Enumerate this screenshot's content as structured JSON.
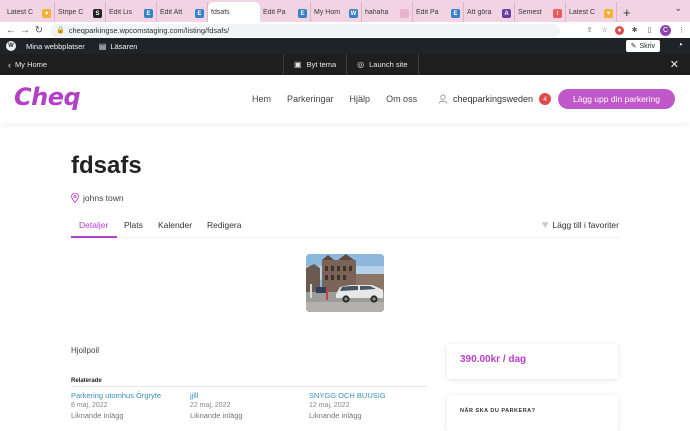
{
  "browser": {
    "tabs": [
      {
        "title": "Latest C",
        "fav_color": "#f2b233",
        "fav_glyph": "♥"
      },
      {
        "title": "Stripe C",
        "fav_color": "#222222",
        "fav_glyph": "S"
      },
      {
        "title": "Edit Lis",
        "fav_color": "#3582c4",
        "fav_glyph": "E"
      },
      {
        "title": "Edit Att",
        "fav_color": "#3582c4",
        "fav_glyph": "E"
      },
      {
        "title": "fdsafs",
        "fav_color": "#ffffff",
        "fav_glyph": "",
        "active": true
      },
      {
        "title": "Edit Pa",
        "fav_color": "#3582c4",
        "fav_glyph": "E"
      },
      {
        "title": "My Hom",
        "fav_color": "#3582c4",
        "fav_glyph": "W"
      },
      {
        "title": "hahaha",
        "fav_color": "#e8b4cc",
        "fav_glyph": ""
      },
      {
        "title": "Edit Pa",
        "fav_color": "#3582c4",
        "fav_glyph": "E"
      },
      {
        "title": "Att göra",
        "fav_color": "#6b3fa0",
        "fav_glyph": "A"
      },
      {
        "title": "Semest",
        "fav_color": "#e85c5c",
        "fav_glyph": "!"
      },
      {
        "title": "Latest C",
        "fav_color": "#f2b233",
        "fav_glyph": "♥"
      }
    ],
    "url": "cheqparkingse.wpcomstaging.com/listing/fdsafs/",
    "profile_initial": "C"
  },
  "wp_admin": {
    "my_sites": "Mina webbplatser",
    "reader": "Läsaren",
    "write": "Skriv"
  },
  "site_editor": {
    "back": "My Home",
    "switch_theme": "Byt tema",
    "launch": "Launch site"
  },
  "header": {
    "logo": "Cheq",
    "nav": [
      "Hem",
      "Parkeringar",
      "Hjälp",
      "Om oss"
    ],
    "username": "cheqparkingsweden",
    "notifications": "4",
    "cta": "Lägg upp din parkering"
  },
  "listing": {
    "title": "fdsafs",
    "location": "johns town",
    "tabs": [
      "Detaljer",
      "Plats",
      "Kalender",
      "Redigera"
    ],
    "favorite": "Lägg till i favoriter",
    "description": "Hjoilpoil",
    "price": "390.00kr / dag",
    "booking_heading": "NÄR SKA DU PARKERA?"
  },
  "related": {
    "heading": "Relaterade",
    "items": [
      {
        "title": "Parkering utomhus Örgryte",
        "date": "8 maj, 2022",
        "kind": "Liknande inlägg"
      },
      {
        "title": "jjlll",
        "date": "22 maj, 2022",
        "kind": "Liknande inlägg"
      },
      {
        "title": "SNYGG OCH BUUSIG",
        "date": "12 maj, 2022",
        "kind": "Liknande inlägg"
      }
    ]
  },
  "colors": {
    "accent": "#b340c6",
    "link": "#3a8fb7",
    "admin_bar": "#1d2327"
  }
}
